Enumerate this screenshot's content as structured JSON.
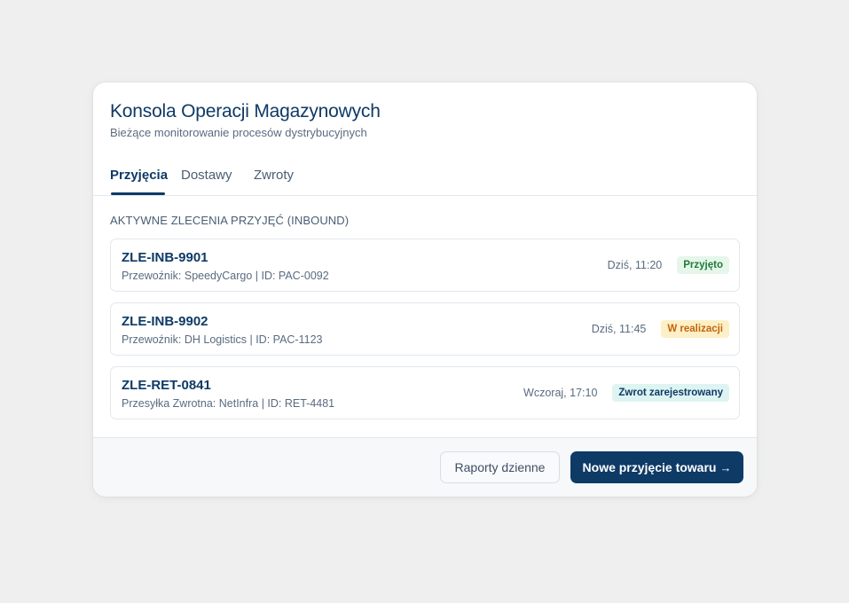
{
  "header": {
    "title": "Konsola Operacji Magazynowych",
    "subtitle": "Bieżące monitorowanie procesów dystrybucyjnych"
  },
  "tabs": [
    {
      "label": "Przyjęcia",
      "active": true
    },
    {
      "label": "Dostawy",
      "active": false
    },
    {
      "label": "Zwroty",
      "active": false
    }
  ],
  "section_label": "AKTYWNE ZLECENIA PRZYJĘĆ (INBOUND)",
  "orders": [
    {
      "id": "ZLE-INB-9901",
      "meta": "Przewoźnik: SpeedyCargo | ID: PAC-0092",
      "time": "Dziś, 11:20",
      "status": "Przyjęto"
    },
    {
      "id": "ZLE-INB-9902",
      "meta": "Przewoźnik: DH Logistics | ID: PAC-1123",
      "time": "Dziś, 11:45",
      "status": "W realizacji"
    },
    {
      "id": "ZLE-RET-0841",
      "meta": "Przesyłka Zwrotna: NetInfra | ID: RET-4481",
      "time": "Wczoraj, 17:10",
      "status": "Zwrot zarejestrowany"
    }
  ],
  "status_colors": {
    "Przyjęto": {
      "bg": "#e6f6ea",
      "fg": "#1f7a3a"
    },
    "W realizacji": {
      "bg": "#fdf0c8",
      "fg": "#c2650a"
    },
    "Zwrot zarejestrowany": {
      "bg": "#def4f2",
      "fg": "#0e3a66"
    }
  },
  "footer": {
    "secondary_label": "Raporty dzienne",
    "primary_label": "Nowe przyjęcie towaru",
    "primary_icon": "arrow-right-icon"
  },
  "colors": {
    "brand": "#0e3a66",
    "background": "#efefef"
  }
}
